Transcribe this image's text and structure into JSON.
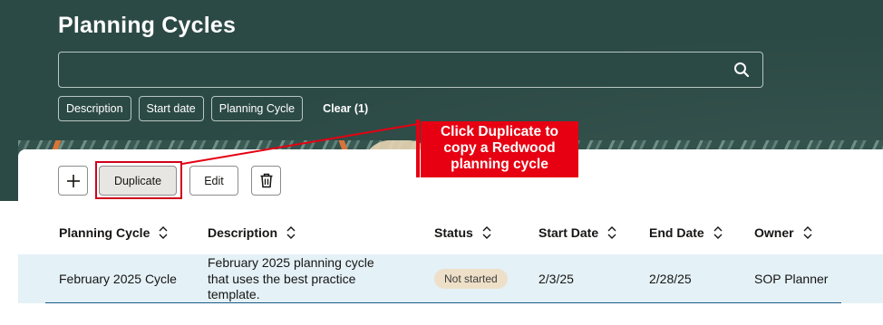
{
  "page": {
    "title": "Planning Cycles",
    "search": {
      "value": "",
      "placeholder": ""
    },
    "filters": [
      "Description",
      "Start date",
      "Planning Cycle"
    ],
    "clear_label": "Clear (1)"
  },
  "toolbar": {
    "add_icon": "plus-icon",
    "duplicate_label": "Duplicate",
    "edit_label": "Edit",
    "delete_icon": "trash-icon"
  },
  "callout": {
    "lines": [
      "Click Duplicate to",
      "copy a Redwood",
      "planning cycle"
    ]
  },
  "table": {
    "columns": [
      "Planning Cycle",
      "Description",
      "Status",
      "Start Date",
      "End Date",
      "Owner"
    ],
    "rows": [
      {
        "planning_cycle": "February 2025 Cycle",
        "description_lines": [
          "February 2025 planning cycle",
          "that uses the best practice",
          "template."
        ],
        "status": "Not started",
        "start_date": "2/3/25",
        "end_date": "2/28/25",
        "owner": "SOP Planner"
      }
    ]
  },
  "colors": {
    "header_bg": "#2c4a45",
    "callout_red": "#e60012",
    "row_selected": "#e4f1f7",
    "status_badge": "#eee0c8"
  }
}
